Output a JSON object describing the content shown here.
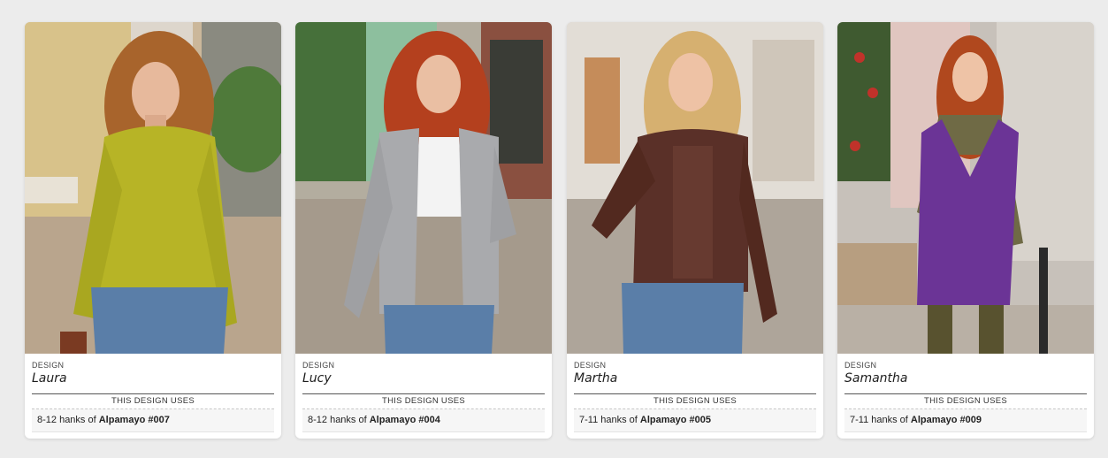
{
  "design_label": "DESIGN",
  "uses_label": "THIS DESIGN USES",
  "cards": [
    {
      "name": "Laura",
      "hanks": "8-12 hanks of",
      "yarn": "Alpamayo #007",
      "sweater_color": "#b7b426",
      "hair_color": "#a8642c"
    },
    {
      "name": "Lucy",
      "hanks": "8-12 hanks of",
      "yarn": "Alpamayo #004",
      "sweater_color": "#a9aaad",
      "hair_color": "#b4401e"
    },
    {
      "name": "Martha",
      "hanks": "7-11 hanks of",
      "yarn": "Alpamayo #005",
      "sweater_color": "#5a3028",
      "hair_color": "#d6b070"
    },
    {
      "name": "Samantha",
      "hanks": "7-11 hanks of",
      "yarn": "Alpamayo #009",
      "sweater_color": "#6b3496",
      "hair_color": "#b0481e"
    }
  ]
}
